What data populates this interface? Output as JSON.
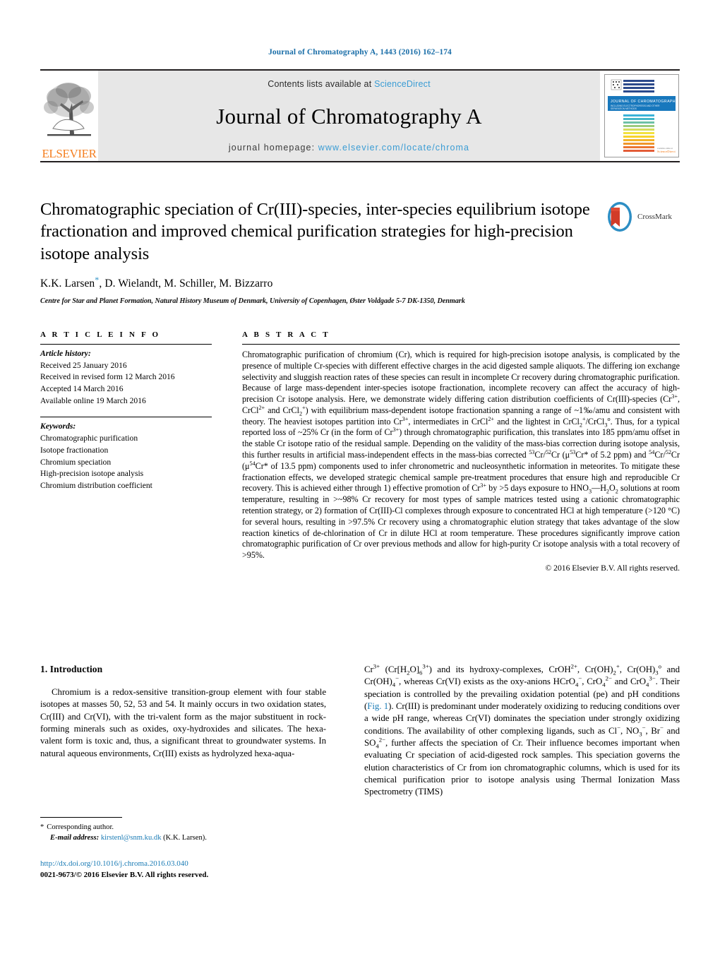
{
  "running_head": "Journal of Chromatography A, 1443 (2016) 162–174",
  "masthead": {
    "contents_prefix": "Contents lists available at",
    "sciencedirect": "ScienceDirect",
    "journal_title": "Journal of Chromatography A",
    "homepage_prefix": "journal homepage:",
    "homepage_url": "www.elsevier.com/locate/chroma",
    "publisher_logo_text": "ELSEVIER",
    "cover_title": "JOURNAL OF CHROMATOGRAPHY A",
    "accent_link_color": "#3a9cd4",
    "publisher_color": "#f57f20"
  },
  "article": {
    "title": "Chromatographic speciation of Cr(III)-species, inter-species equilibrium isotope fractionation and improved chemical purification strategies for high-precision isotope analysis",
    "authors": "K.K. Larsen, D. Wielandt, M. Schiller, M. Bizzarro",
    "authors_pre_star": "K.K. Larsen",
    "authors_post_star": ", D. Wielandt, M. Schiller, M. Bizzarro",
    "corresponding_marker": "*",
    "affiliation": "Centre for Star and Planet Formation, Natural History Museum of Denmark, University of Copenhagen, Øster Voldgade 5-7 DK-1350, Denmark",
    "crossmark_label": "CrossMark"
  },
  "article_info": {
    "heading": "A R T I C L E    I N F O",
    "history_label": "Article history:",
    "history": [
      "Received 25 January 2016",
      "Received in revised form 12 March 2016",
      "Accepted 14 March 2016",
      "Available online 19 March 2016"
    ],
    "keywords_label": "Keywords:",
    "keywords": [
      "Chromatographic purification",
      "Isotope fractionation",
      "Chromium speciation",
      "High-precision isotope analysis",
      "Chromium distribution coefficient"
    ]
  },
  "abstract": {
    "heading": "A B S T R A C T",
    "text_part1": "Chromatographic purification of chromium (Cr), which is required for high-precision isotope analysis, is complicated by the presence of multiple Cr-species with different effective charges in the acid digested sample aliquots. The differing ion exchange selectivity and sluggish reaction rates of these species can result in incomplete Cr recovery during chromatographic purification. Because of large mass-dependent inter-species isotope fractionation, incomplete recovery can affect the accuracy of high-precision Cr isotope analysis. Here, we demonstrate widely differing cation distribution coefficients of Cr(III)-species (Cr",
    "text_part2": " and CrCl",
    "text_part3": ") with equilibrium mass-dependent isotope fractionation spanning a range of ~1‰/amu and consistent with theory. The heaviest isotopes partition into Cr",
    "text_part4": ", intermediates in CrCl",
    "text_part5": " and the lightest in CrCl",
    "text_part6": "/CrCl",
    "text_part7": ". Thus, for a typical reported loss of ~25% Cr (in the form of Cr",
    "text_part8": ") through chromatographic purification, this translates into 185 ppm/amu offset in the stable Cr isotope ratio of the residual sample. Depending on the validity of the mass-bias correction during isotope analysis, this further results in artificial mass-independent effects in the mass-bias corrected ",
    "text_part9": "Cr/",
    "text_part10": "Cr (μ",
    "text_part11": "Cr* of 5.2 ppm) and ",
    "text_part12": "Cr/",
    "text_part13": "Cr (μ",
    "text_part14": "Cr* of 13.5 ppm) components used to infer chronometric and nucleosynthetic information in meteorites. To mitigate these fractionation effects, we developed strategic chemical sample pre-treatment procedures that ensure high and reproducible Cr recovery. This is achieved either through 1) effective promotion of Cr",
    "text_part15": " by >5 days exposure to HNO",
    "text_part16": "—H",
    "text_part17": "O",
    "text_part18": " solutions at room temperature, resulting in >~98% Cr recovery for most types of sample matrices tested using a cationic chromatographic retention strategy, or 2) formation of Cr(III)-Cl complexes through exposure to concentrated HCl at high temperature (>120 °C) for several hours, resulting in >97.5% Cr recovery using a chromatographic elution strategy that takes advantage of the slow reaction kinetics of de-chlorination of Cr in dilute HCl at room temperature. These procedures significantly improve cation chromatographic purification of Cr over previous methods and allow for high-purity Cr isotope analysis with a total recovery of >95%.",
    "copyright": "© 2016 Elsevier B.V. All rights reserved."
  },
  "introduction": {
    "heading": "1.  Introduction",
    "left_paragraph": "Chromium is a redox-sensitive transition-group element with four stable isotopes at masses 50, 52, 53 and 54. It mainly occurs in two oxidation states, Cr(III) and Cr(VI), with the tri-valent form as the major substituent in rock-forming minerals such as oxides, oxy-hydroxides and silicates. The hexa-valent form is toxic and, thus, a significant threat to groundwater systems. In natural aqueous environments, Cr(III) exists as hydrolyzed hexa-aqua-",
    "right_part1": "Cr",
    "right_part2": " (Cr[H",
    "right_part3": "O]",
    "right_part4": ") and its hydroxy-complexes, CrOH",
    "right_part5": ", Cr(OH)",
    "right_part6": ", Cr(OH)",
    "right_part7": " and Cr(OH)",
    "right_part8": ", whereas Cr(VI) exists as the oxy-anions HCrO",
    "right_part9": ", CrO",
    "right_part10": " and CrO",
    "right_part11": ". Their speciation is controlled by the prevailing oxidation potential (pe) and pH conditions (",
    "fig_link": "Fig. 1",
    "right_part12": "). Cr(III) is predominant under moderately oxidizing to reducing conditions over a wide pH range, whereas Cr(VI) dominates the speciation under strongly oxidizing conditions. The availability of other complexing ligands, such as Cl",
    "right_part13": ", NO",
    "right_part14": ", Br",
    "right_part15": " and SO",
    "right_part16": ", further affects the speciation of Cr. Their influence becomes important when evaluating Cr speciation of acid-digested rock samples. This speciation governs the elution characteristics of Cr from ion chromatographic columns, which is used for its chemical purification prior to isotope analysis using Thermal Ionization Mass Spectrometry (TIMS)"
  },
  "footnote": {
    "star": "*",
    "corresponding": "Corresponding author.",
    "email_label": "E-mail address:",
    "email": "kirstenl@snm.ku.dk",
    "email_suffix": "(K.K. Larsen).",
    "doi": "http://dx.doi.org/10.1016/j.chroma.2016.03.040",
    "issn": "0021-9673/© 2016 Elsevier B.V. All rights reserved."
  }
}
